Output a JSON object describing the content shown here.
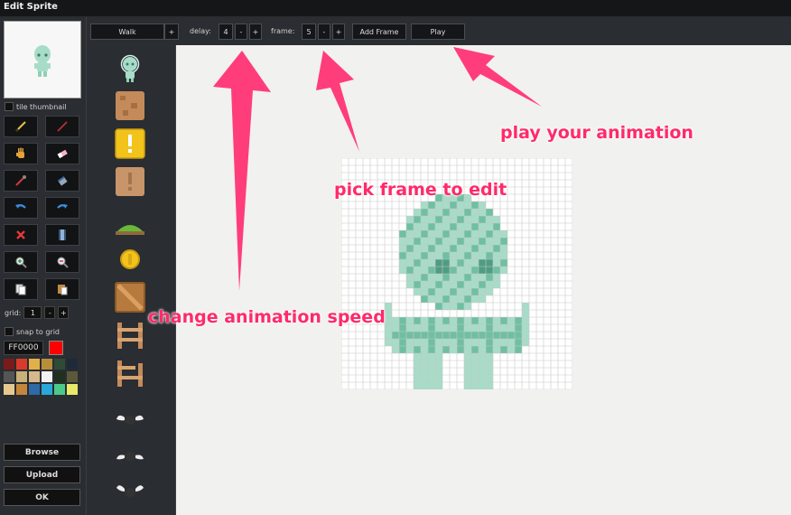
{
  "window": {
    "title": "Edit Sprite"
  },
  "left_panel": {
    "tile_thumbnail_label": "tile thumbnail",
    "tools": [
      {
        "name": "pencil-icon"
      },
      {
        "name": "line-icon"
      },
      {
        "name": "hand-icon"
      },
      {
        "name": "eraser-icon"
      },
      {
        "name": "eyedropper-icon"
      },
      {
        "name": "fill-icon"
      },
      {
        "name": "undo-icon"
      },
      {
        "name": "redo-icon"
      },
      {
        "name": "clear-icon"
      },
      {
        "name": "filmstrip-icon"
      },
      {
        "name": "zoom-in-icon"
      },
      {
        "name": "zoom-out-icon"
      },
      {
        "name": "copy-icon"
      },
      {
        "name": "paste-icon"
      }
    ],
    "grid_label": "grid:",
    "grid_value": "1",
    "minus": "-",
    "plus": "+",
    "snap_label": "snap to grid",
    "color_hex": "FF0000",
    "current_color": "#ff0000",
    "palette": [
      "#7b1a1a",
      "#d93a2b",
      "#e2b04a",
      "#b78f3a",
      "#2f4a37",
      "#1f2a38",
      "#555555",
      "#c9b27a",
      "#d7b98e",
      "#f2f2f2",
      "#20301f",
      "#5a5a3a",
      "#e7c98f",
      "#c4863a",
      "#2d6aa6",
      "#28a8d8",
      "#4ac98a",
      "#e9e96a"
    ],
    "browse_label": "Browse",
    "upload_label": "Upload",
    "ok_label": "OK"
  },
  "toolbar": {
    "animation_name": "Walk",
    "add_animation": "+",
    "delay_label": "delay:",
    "delay_value": "4",
    "frame_label": "frame:",
    "frame_value": "5",
    "minus": "-",
    "plus": "+",
    "add_frame_label": "Add Frame",
    "play_label": "Play"
  },
  "tiles": [
    "alien-sprite-icon",
    "dirt-block-icon",
    "yellow-bonus-block-icon",
    "brown-bonus-block-icon",
    "grass-ledge-icon",
    "coin-icon",
    "wooden-crate-icon",
    "fence-icon",
    "broken-fence-icon",
    "fly-enemy-icon",
    "fly-enemy-2-icon",
    "fly-enemy-3-icon"
  ],
  "annotations": {
    "speed": "change animation speed",
    "frame": "pick frame to edit",
    "play": "play your animation"
  },
  "colors": {
    "accent": "#ff2a6a",
    "sprite_light": "#a7dcc9",
    "sprite_dark": "#6fbfa3"
  }
}
